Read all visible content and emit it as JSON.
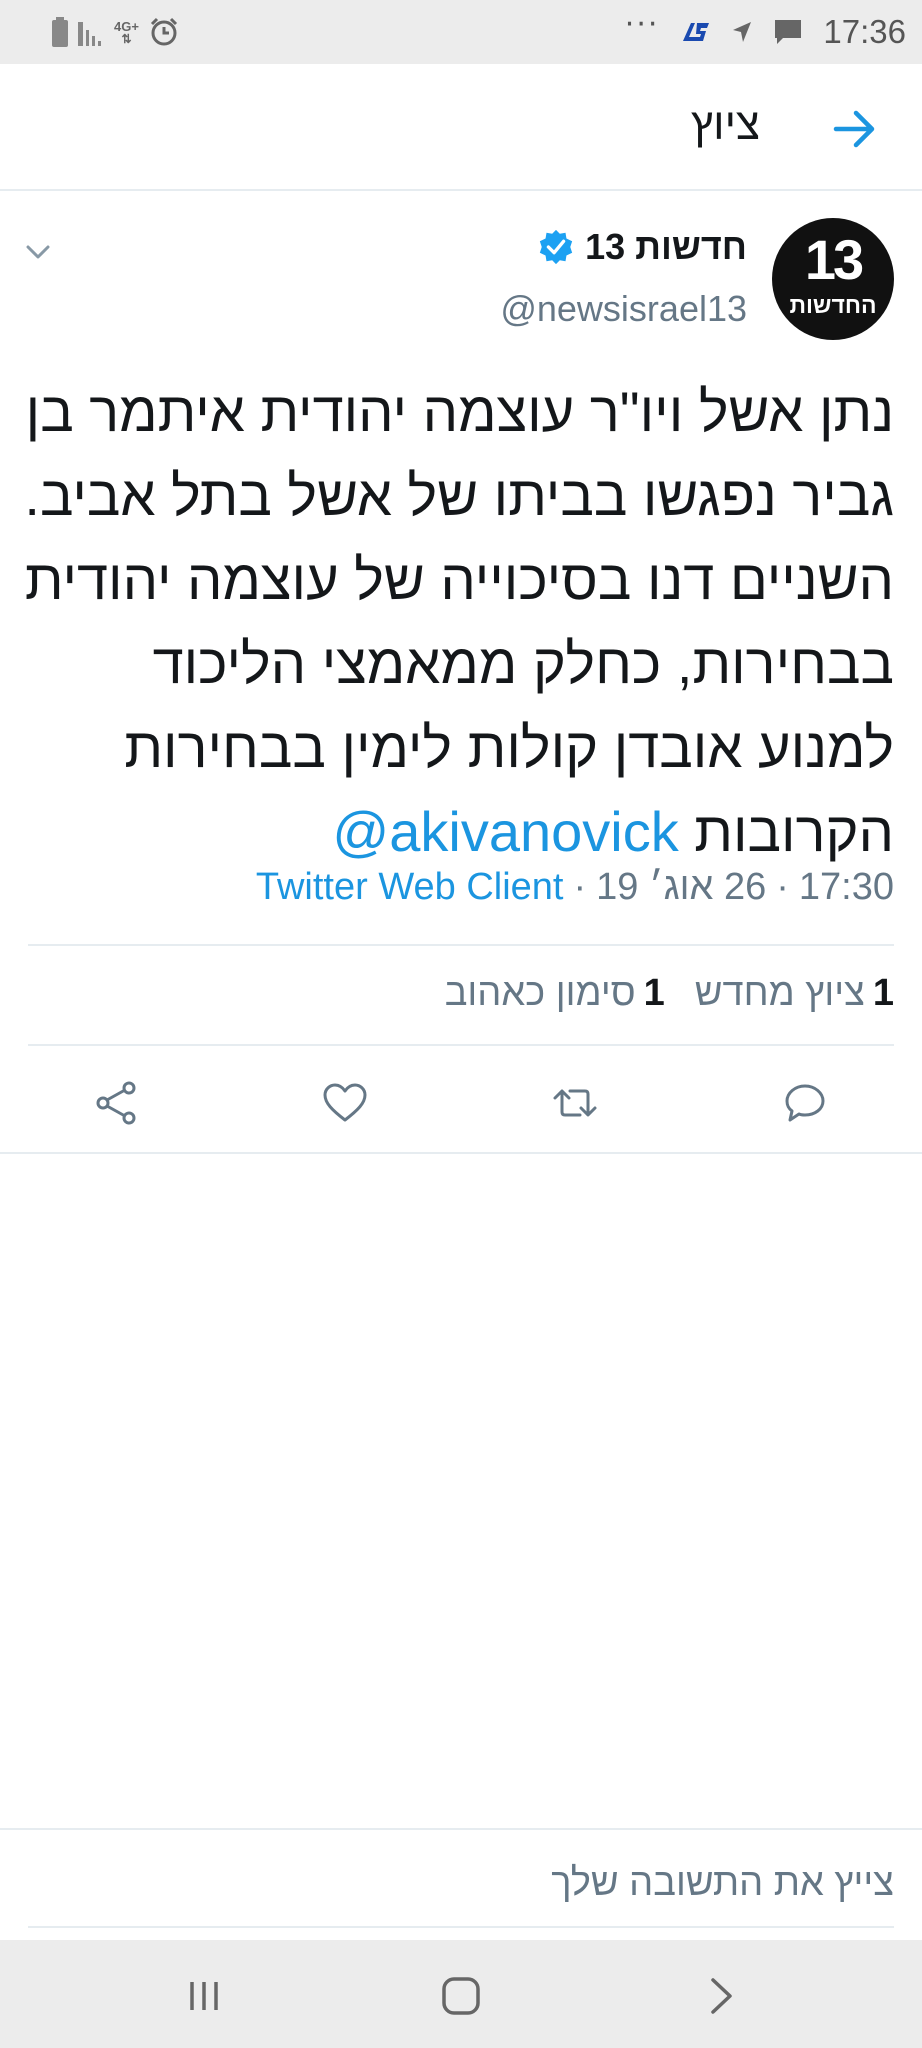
{
  "status_bar": {
    "time": "17:36",
    "network": "4G+",
    "more": "···",
    "icons": [
      "battery-icon",
      "signal-icon",
      "alarm-icon",
      "app-logo-icon",
      "location-icon",
      "message-icon"
    ]
  },
  "header": {
    "title": "ציוץ",
    "back_icon": "arrow-right-icon"
  },
  "tweet": {
    "avatar": {
      "number": "13",
      "word": "החדשות"
    },
    "author_name": "חדשות 13",
    "handle": "@newsisrael13",
    "text": "נתן אשל ויו\"ר עוצמה יהודית איתמר בן גביר נפגשו בביתו של אשל בתל אביב. השניים דנו בסיכוייה של עוצמה יהודית בבחירות, כחלק ממאמצי הליכוד למנוע אובדן קולות לימין בבחירות הקרובות",
    "mention": "@akivanovick",
    "time": "17:30",
    "date": "26 אוג׳ 19",
    "separator": "·",
    "client": "Twitter Web Client",
    "stats": {
      "retweets_count": "1",
      "retweets_label": "ציוץ מחדש",
      "likes_count": "1",
      "likes_label": "סימון כאהוב"
    }
  },
  "reply": {
    "placeholder": "צייץ את התשובה שלך"
  },
  "colors": {
    "accent": "#1b95e0",
    "text": "#14171a",
    "muted": "#657786",
    "divider": "#e6ecf0"
  }
}
